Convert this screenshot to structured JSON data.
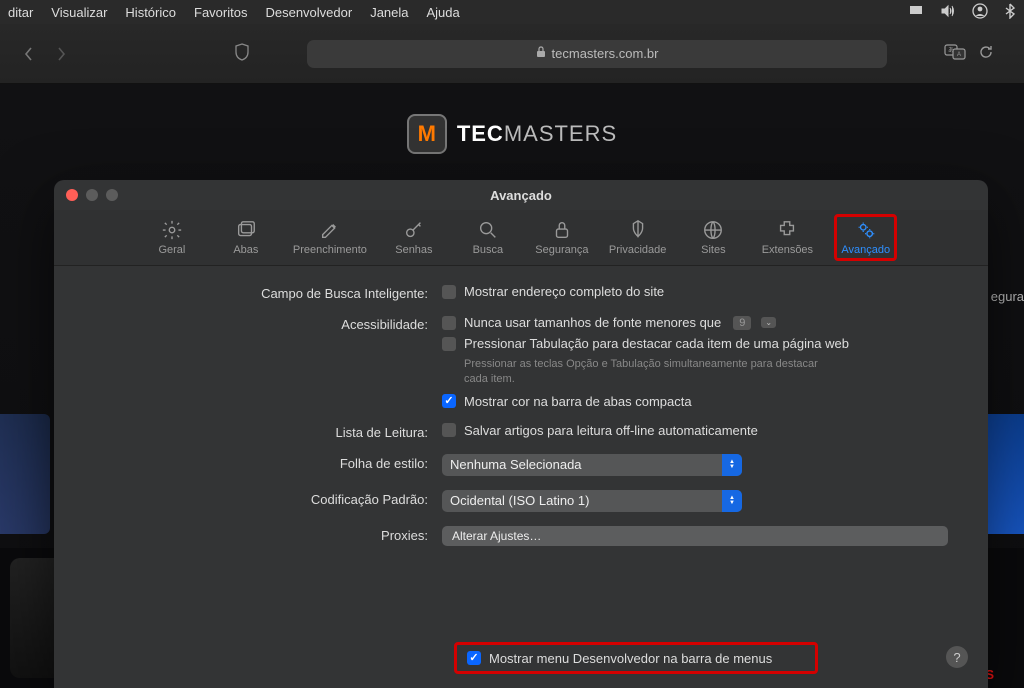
{
  "menubar": {
    "items": [
      "ditar",
      "Visualizar",
      "Histórico",
      "Favoritos",
      "Desenvolvedor",
      "Janela",
      "Ajuda"
    ]
  },
  "browser": {
    "url_display": "tecmasters.com.br"
  },
  "site": {
    "brand_prefix": "TEC",
    "brand_suffix": "MASTERS",
    "logo_letter": "M",
    "sidebar_hint": "egura",
    "games_label": "GAMES"
  },
  "pref": {
    "title": "Avançado",
    "tabs": {
      "geral": "Geral",
      "abas": "Abas",
      "preench": "Preenchimento",
      "senhas": "Senhas",
      "busca": "Busca",
      "seguranca": "Segurança",
      "privacidade": "Privacidade",
      "sites": "Sites",
      "extensoes": "Extensões",
      "avancado": "Avançado"
    },
    "rows": {
      "smart_search_label": "Campo de Busca Inteligente:",
      "smart_search_opt": "Mostrar endereço completo do site",
      "accessibility_label": "Acessibilidade:",
      "acc_min_font": "Nunca usar tamanhos de fonte menores que",
      "acc_min_font_value": "9",
      "acc_tab": "Pressionar Tabulação para destacar cada item de uma página web",
      "acc_tab_hint": "Pressionar as teclas Opção e Tabulação simultaneamente para destacar cada item.",
      "acc_tabcolor": "Mostrar cor na barra de abas compacta",
      "reading_label": "Lista de Leitura:",
      "reading_opt": "Salvar artigos para leitura off-line automaticamente",
      "stylesheet_label": "Folha de estilo:",
      "stylesheet_value": "Nenhuma Selecionada",
      "encoding_label": "Codificação Padrão:",
      "encoding_value": "Ocidental (ISO Latino 1)",
      "proxies_label": "Proxies:",
      "proxies_btn": "Alterar Ajustes…",
      "dev_menu": "Mostrar menu Desenvolvedor na barra de menus",
      "help": "?"
    }
  }
}
